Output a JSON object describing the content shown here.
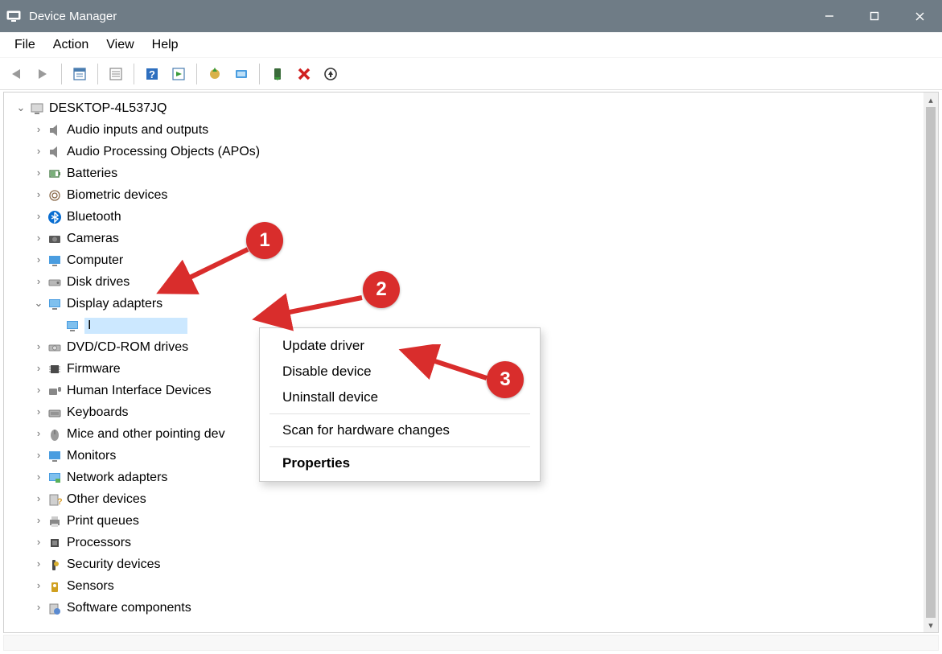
{
  "window": {
    "title": "Device Manager"
  },
  "menu": {
    "file": "File",
    "action": "Action",
    "view": "View",
    "help": "Help"
  },
  "tree": {
    "root": "DESKTOP-4L537JQ",
    "items": [
      "Audio inputs and outputs",
      "Audio Processing Objects (APOs)",
      "Batteries",
      "Biometric devices",
      "Bluetooth",
      "Cameras",
      "Computer",
      "Disk drives",
      "Display adapters",
      "DVD/CD-ROM drives",
      "Firmware",
      "Human Interface Devices",
      "Keyboards",
      "Mice and other pointing dev",
      "Monitors",
      "Network adapters",
      "Other devices",
      "Print queues",
      "Processors",
      "Security devices",
      "Sensors",
      "Software components"
    ],
    "selected_child": "I"
  },
  "context_menu": {
    "update": "Update driver",
    "disable": "Disable device",
    "uninstall": "Uninstall device",
    "scan": "Scan for hardware changes",
    "properties": "Properties"
  },
  "annotations": {
    "a1": "1",
    "a2": "2",
    "a3": "3"
  }
}
